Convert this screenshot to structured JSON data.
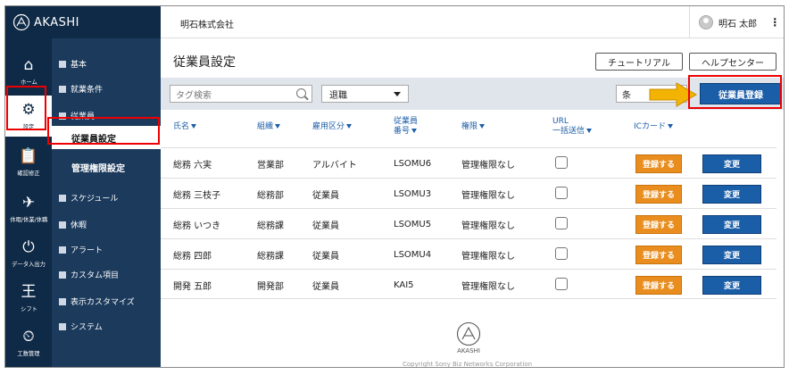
{
  "brand": {
    "name": "AKASHI"
  },
  "topbar": {
    "company": "明石株式会社",
    "user_name": "明石 太郎",
    "menu_icon": "⋮"
  },
  "rail": {
    "items": [
      {
        "label": "ホーム",
        "icon": "⌂"
      },
      {
        "label": "設定",
        "icon": "⚙"
      },
      {
        "label": "確認修正",
        "icon": "📋"
      },
      {
        "label": "休暇/休業/休職",
        "icon": "✈"
      },
      {
        "label": "データ入出力",
        "icon": "⏻"
      },
      {
        "label": "シフト",
        "icon": "王"
      },
      {
        "label": "工数管理",
        "icon": "⏲"
      }
    ]
  },
  "submenu": {
    "items": [
      "基本",
      "就業条件",
      "従業員",
      "従業員設定",
      "管理権限設定",
      "スケジュール",
      "休暇",
      "アラート",
      "カスタム項目",
      "表示カスタマイズ",
      "システム"
    ]
  },
  "page": {
    "title": "従業員設定",
    "tutorial_label": "チュートリアル",
    "help_label": "ヘルプセンター"
  },
  "filters": {
    "search_placeholder": "タグ検索",
    "status_selected": "退職",
    "condition_label": "条",
    "register_label": "従業員登録"
  },
  "table": {
    "headers": [
      "氏名",
      "組織",
      "雇用区分",
      "従業員",
      "番号",
      "権限",
      "URL",
      "一括送信",
      "ICカード"
    ],
    "rows": [
      {
        "name": "総務 六実",
        "org": "営業部",
        "type": "アルバイト",
        "id": "LSOMU6",
        "role": "管理権限なし"
      },
      {
        "name": "総務 三枝子",
        "org": "総務部",
        "type": "従業員",
        "id": "LSOMU3",
        "role": "管理権限なし"
      },
      {
        "name": "総務 いつき",
        "org": "総務課",
        "type": "従業員",
        "id": "LSOMU5",
        "role": "管理権限なし"
      },
      {
        "name": "総務 四郎",
        "org": "総務課",
        "type": "従業員",
        "id": "LSOMU4",
        "role": "管理権限なし"
      },
      {
        "name": "開発 五郎",
        "org": "開発部",
        "type": "従業員",
        "id": "KAI5",
        "role": "管理権限なし"
      }
    ],
    "register_btn": "登録する",
    "edit_btn": "変更"
  },
  "footer": {
    "brand": "AKASHI",
    "copyright": "Copyright Sony Biz Networks Corporation"
  },
  "colors": {
    "navy": "#0f2a47",
    "blue": "#1b5ea8",
    "orange": "#e88d1e",
    "highlight": "#e00000",
    "arrow": "#f2b400"
  }
}
